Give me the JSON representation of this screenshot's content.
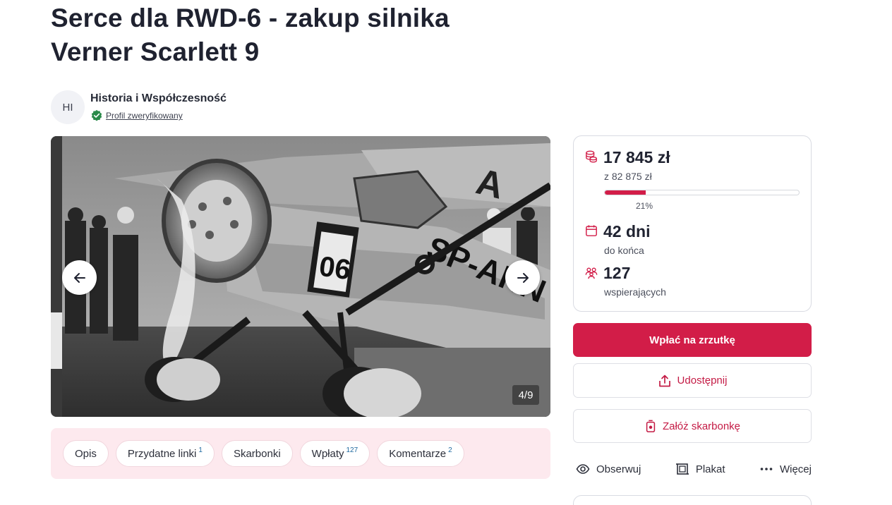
{
  "campaign": {
    "title_line1": "Serce dla RWD-6 - zakup silnika",
    "title_line2": "Verner Scarlett 9"
  },
  "organizer": {
    "initials": "HI",
    "name": "Historia i Współczesność",
    "verified_label": "Profil zweryfikowany"
  },
  "gallery": {
    "counter": "4/9",
    "current": 4,
    "total": 9,
    "plane_number": "06",
    "plane_registration": "SP-AHN",
    "icons": {
      "prev": "arrow-left-icon",
      "next": "arrow-right-icon"
    }
  },
  "tabs": [
    {
      "label": "Opis",
      "count": ""
    },
    {
      "label": "Przydatne linki",
      "count": "1"
    },
    {
      "label": "Skarbonki",
      "count": ""
    },
    {
      "label": "Wpłaty",
      "count": "127"
    },
    {
      "label": "Komentarze",
      "count": "2"
    }
  ],
  "stats": {
    "raised": "17 845 zł",
    "goal": "z 82 875 zł",
    "progress_percent": 21,
    "progress_label": "21%",
    "days": "42 dni",
    "days_label": "do końca",
    "supporters": "127",
    "supporters_label": "wspierających",
    "icons": {
      "raised": "coins-icon",
      "days": "calendar-icon",
      "supporters": "people-icon"
    }
  },
  "buttons": {
    "donate": "Wpłać na zrzutkę",
    "share": "Udostępnij",
    "piggy_bank": "Załóż skarbonkę"
  },
  "actions": {
    "watch": "Obserwuj",
    "poster": "Plakat",
    "more": "Więcej"
  },
  "colors": {
    "accent": "#d21d48",
    "tab_bar_bg": "#fde9ee",
    "verified_green": "#2a8a4a"
  }
}
